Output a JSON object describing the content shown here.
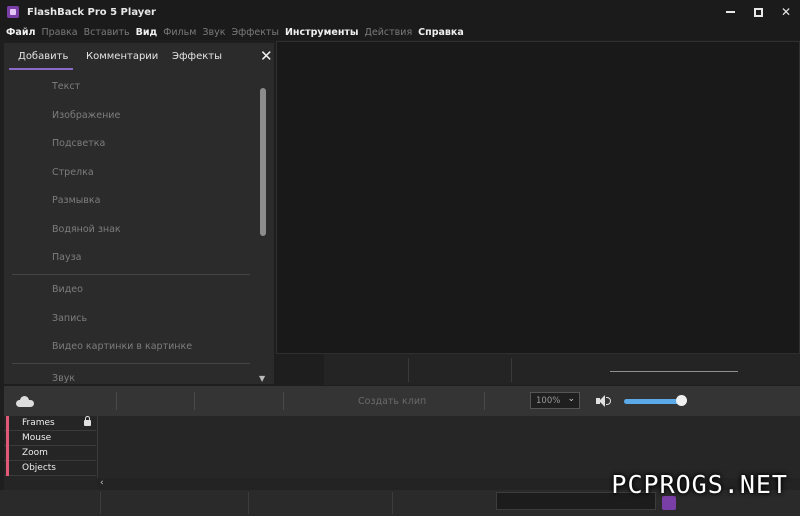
{
  "window": {
    "title": "FlashBack Pro 5 Player",
    "controls": {
      "minimize": "minimize-icon",
      "maximize": "maximize-icon",
      "close": "✕"
    }
  },
  "menu": {
    "items": [
      {
        "label": "Файл",
        "active": true
      },
      {
        "label": "Правка",
        "active": false
      },
      {
        "label": "Вставить",
        "active": false
      },
      {
        "label": "Вид",
        "active": true
      },
      {
        "label": "Фильм",
        "active": false
      },
      {
        "label": "Звук",
        "active": false
      },
      {
        "label": "Эффекты",
        "active": false
      },
      {
        "label": "Инструменты",
        "active": true
      },
      {
        "label": "Действия",
        "active": false
      },
      {
        "label": "Справка",
        "active": true
      }
    ]
  },
  "panel": {
    "tabs": [
      "Добавить",
      "Комментарии",
      "Эффекты"
    ],
    "active_tab": "Добавить",
    "close": "✕",
    "effects": [
      "Текст",
      "Изображение",
      "Подсветка",
      "Стрелка",
      "Размывка",
      "Водяной знак",
      "Пауза",
      "Видео",
      "Запись",
      "Видео картинки в картинке",
      "Звук"
    ]
  },
  "toolbar": {
    "create_clip": "Создать клип",
    "zoom": "100%",
    "zoom_chevron": "⌄",
    "volume": 0.95
  },
  "timeline": {
    "tracks": [
      "Frames",
      "Mouse",
      "Zoom",
      "Objects"
    ],
    "scroll_left": "‹"
  },
  "watermark": "PCPROGS.NET",
  "colors": {
    "accent": "#8a6ac6",
    "track_marker": "#e05a78",
    "volume_fill": "#5aa9e8",
    "app_icon": "#7a3fa6"
  }
}
